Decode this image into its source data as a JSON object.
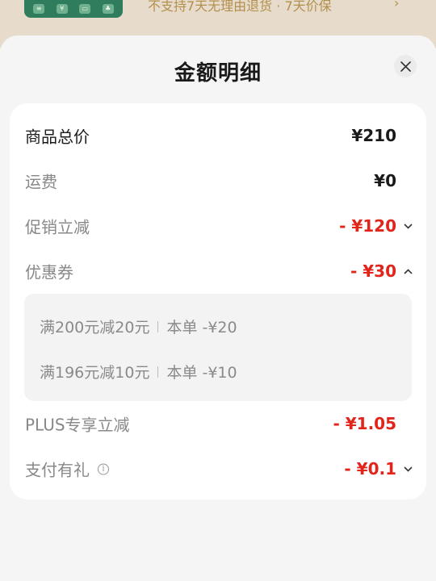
{
  "background_banner": {
    "text": "不支持7天无理由退货 · 7天价保",
    "chevron": "›",
    "thumb_icons": [
      "≡",
      "¥",
      "▭",
      "♣"
    ]
  },
  "sheet": {
    "title": "金额明细",
    "close_label": "×"
  },
  "rows": [
    {
      "label": "商品总价",
      "value": "¥210"
    },
    {
      "label": "运费",
      "value": "¥0"
    },
    {
      "label": "促销立减",
      "value": "- ¥120"
    },
    {
      "label": "优惠券",
      "value": "- ¥30"
    },
    {
      "label": "PLUS专享立减",
      "value": "- ¥1.05"
    },
    {
      "label": "支付有礼",
      "value": "- ¥0.1"
    }
  ],
  "coupons": [
    {
      "rule": "满200元减20元",
      "detail": "本单 -¥20"
    },
    {
      "rule": "满196元减10元",
      "detail": "本单 -¥10"
    }
  ],
  "colors": {
    "accent_red": "#e1251b",
    "label_gray": "#888888",
    "title_black": "#1a1a1a"
  }
}
